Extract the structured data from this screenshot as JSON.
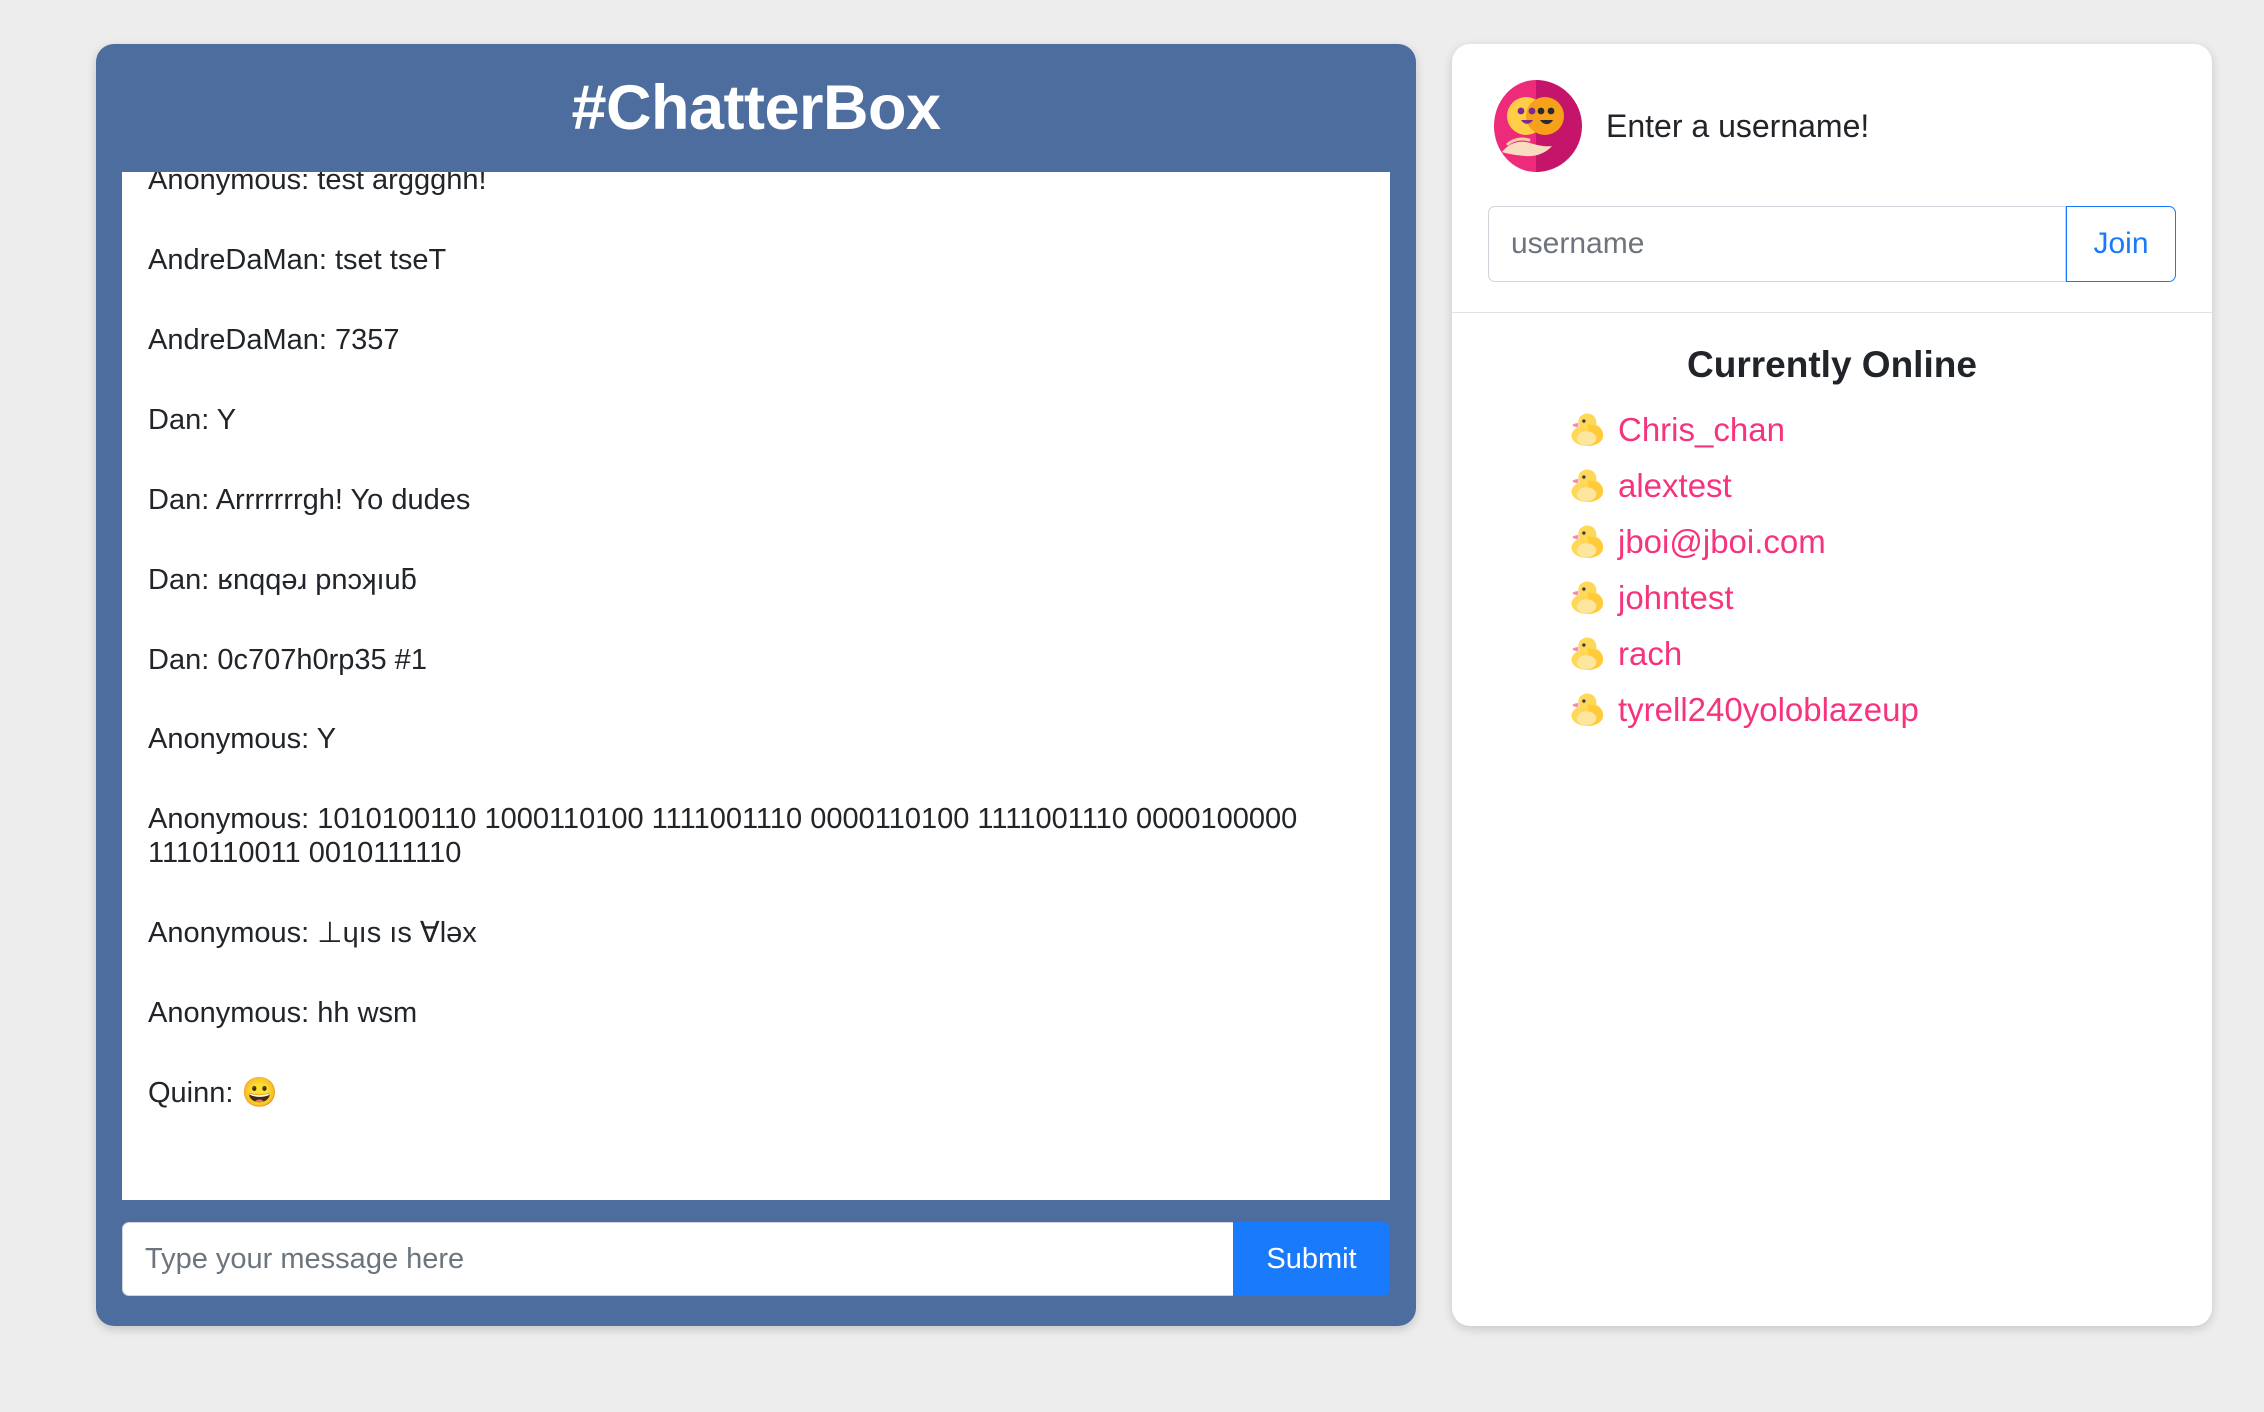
{
  "chat": {
    "title": "#ChatterBox",
    "messages": [
      {
        "text": "Anonymous: test arggghh!",
        "clipped": true
      },
      {
        "text": "AndreDaMan: tset tseT"
      },
      {
        "text": "AndreDaMan: 7357"
      },
      {
        "text": "Dan: Y"
      },
      {
        "text": "Dan: Arrrrrrrgh! Yo dudes"
      },
      {
        "text": "Dan: ʁnqqǝɹ pnɔʞıuƃ"
      },
      {
        "text": "Dan: 0c707h0rp35 #1"
      },
      {
        "text": "Anonymous: Y"
      },
      {
        "text": "Anonymous: 1010100110 1000110100 1111001110 0000110100 1111001110 0000100000 1110110011 0010111110"
      },
      {
        "text": "Anonymous: ⊥ɥıs ıs ∀ləx"
      },
      {
        "text": "Anonymous: hh wsm"
      },
      {
        "text": "Quinn: 😀"
      }
    ],
    "composer": {
      "placeholder": "Type your message here",
      "value": "",
      "submit_label": "Submit"
    }
  },
  "sidebar": {
    "prompt": "Enter a username!",
    "avatar_icon": "two-smiling-faces-in-hand-icon",
    "username_field": {
      "placeholder": "username",
      "value": ""
    },
    "join_label": "Join",
    "online_title": "Currently Online",
    "online_users": [
      {
        "name": "Chris_chan",
        "icon": "duck-icon"
      },
      {
        "name": "alextest",
        "icon": "duck-icon"
      },
      {
        "name": "jboi@jboi.com",
        "icon": "duck-icon"
      },
      {
        "name": "johntest",
        "icon": "duck-icon"
      },
      {
        "name": "rach",
        "icon": "duck-icon"
      },
      {
        "name": "tyrell240yoloblazeup",
        "icon": "duck-icon"
      }
    ]
  },
  "colors": {
    "header_blue": "#4d6d9e",
    "submit_blue": "#1a7afc",
    "join_blue": "#1a7afc",
    "username_pink": "#f5337f",
    "page_background": "#ededed"
  }
}
